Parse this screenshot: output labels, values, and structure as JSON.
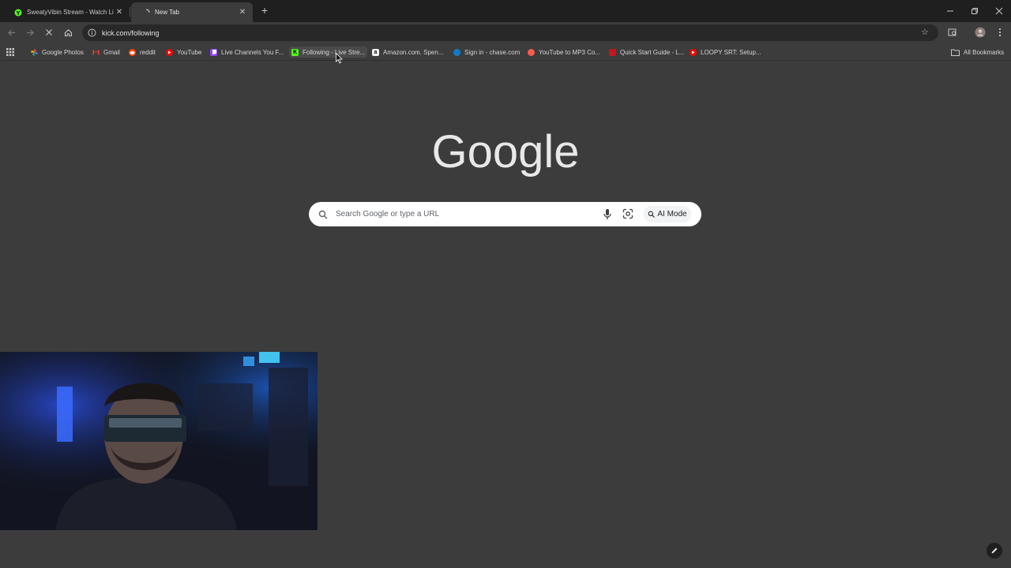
{
  "tabs": [
    {
      "title": "SweatyVibin Stream - Watch Li",
      "favicon": "kick-icon",
      "active": false
    },
    {
      "title": "New Tab",
      "favicon": "loading-icon",
      "active": true
    }
  ],
  "window_controls": {
    "minimize": "minimize-icon",
    "restore": "restore-icon",
    "close": "close-icon"
  },
  "toolbar": {
    "url": "kick.com/following"
  },
  "bookmarks": [
    {
      "label": "Google Photos",
      "icon": "google-photos-icon",
      "color": "#fbbc04"
    },
    {
      "label": "Gmail",
      "icon": "gmail-icon",
      "color": "#ea4335"
    },
    {
      "label": "reddit",
      "icon": "reddit-icon",
      "color": "#ff4500"
    },
    {
      "label": "YouTube",
      "icon": "youtube-icon",
      "color": "#ff0000"
    },
    {
      "label": "Live Channels You F...",
      "icon": "twitch-icon",
      "color": "#9146ff"
    },
    {
      "label": "Following - Live Stre...",
      "icon": "kick-icon",
      "color": "#53fc18"
    },
    {
      "label": "Amazon.com. Spen...",
      "icon": "amazon-icon",
      "color": "#f2f2f2"
    },
    {
      "label": "Sign in - chase.com",
      "icon": "chase-icon",
      "color": "#117aca"
    },
    {
      "label": "YouTube to MP3 Co...",
      "icon": "converter-icon",
      "color": "#ff5a4e"
    },
    {
      "label": "Quick Start Guide - L...",
      "icon": "guide-icon",
      "color": "#c4161c"
    },
    {
      "label": "LOOPY SRT: Setup...",
      "icon": "youtube-icon",
      "color": "#ff0000"
    }
  ],
  "all_bookmarks": "All Bookmarks",
  "ntp": {
    "logo_text": "Google",
    "search_placeholder": "Search Google or type a URL",
    "ai_mode_label": "AI Mode"
  },
  "colors": {
    "background": "#3c3c3c",
    "tab_strip": "#1f1f1f",
    "omnibox": "#282828",
    "searchbox": "#ffffff"
  }
}
